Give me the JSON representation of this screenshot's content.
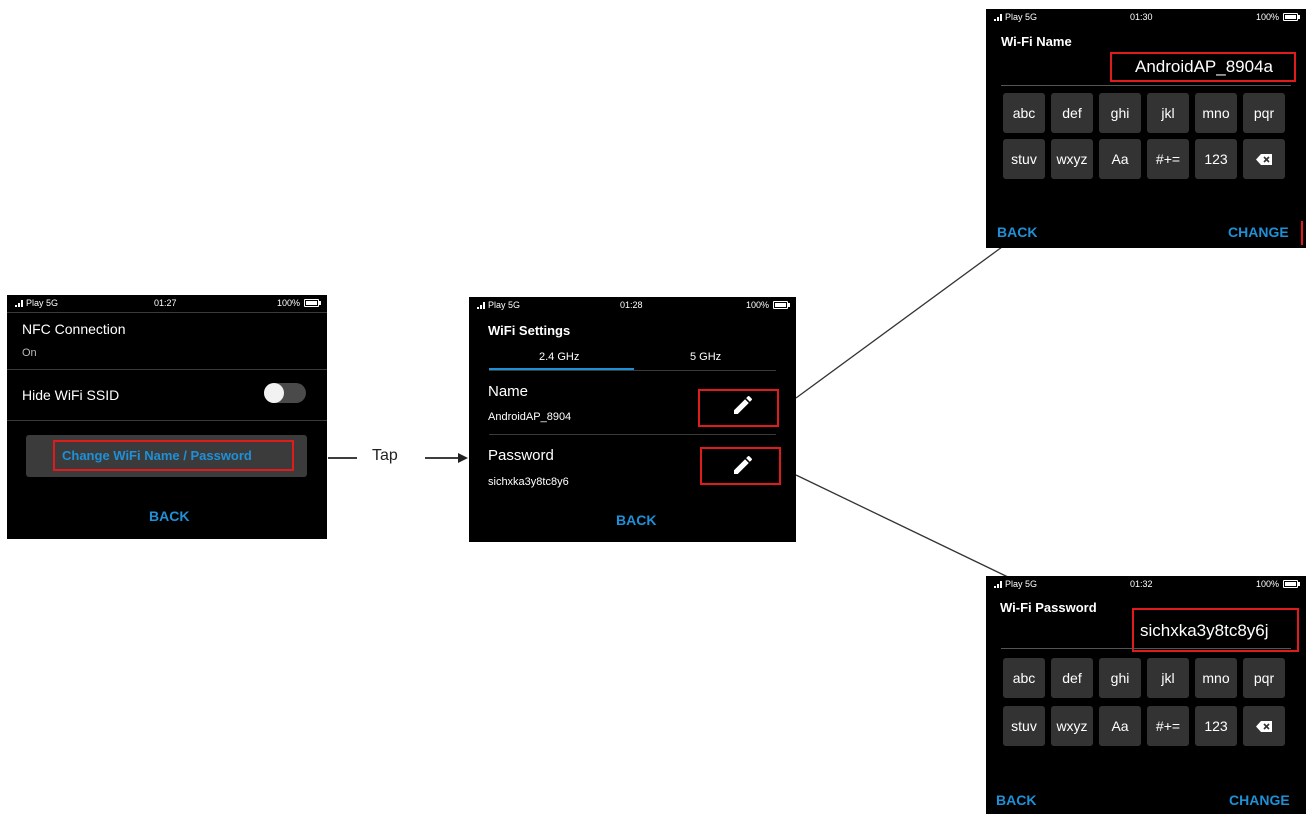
{
  "status": {
    "carrier": "Play 5G",
    "battery": "100%",
    "time1": "01:27",
    "time2": "01:28",
    "time3": "01:30",
    "time4": "01:32"
  },
  "screen1": {
    "nfc_title": "NFC Connection",
    "nfc_value": "On",
    "hide_ssid_label": "Hide WiFi SSID",
    "hide_ssid_on": false,
    "change_button": "Change WiFi Name / Password",
    "back": "BACK"
  },
  "flow": {
    "tap_label": "Tap"
  },
  "screen2": {
    "title": "WiFi Settings",
    "tab_24": "2.4 GHz",
    "tab_5": "5 GHz",
    "name_label": "Name",
    "name_value": "AndroidAP_8904",
    "password_label": "Password",
    "password_value": "sichxka3y8tc8y6",
    "back": "BACK"
  },
  "screen3": {
    "title": "Wi-Fi Name",
    "value": "AndroidAP_8904a",
    "back": "BACK",
    "change": "CHANGE"
  },
  "screen4": {
    "title": "Wi-Fi Password",
    "value": "sichxka3y8tc8y6j",
    "back": "BACK",
    "change": "CHANGE"
  },
  "keyboard": {
    "row1": [
      "abc",
      "def",
      "ghi",
      "jkl",
      "mno",
      "pqr"
    ],
    "row2": [
      "stuv",
      "wxyz",
      "Aa",
      "#+=",
      "123"
    ]
  },
  "colors": {
    "accent": "#1e90d8",
    "highlight": "#e01b1b",
    "screen_bg": "#000000",
    "key_bg": "#333333"
  }
}
